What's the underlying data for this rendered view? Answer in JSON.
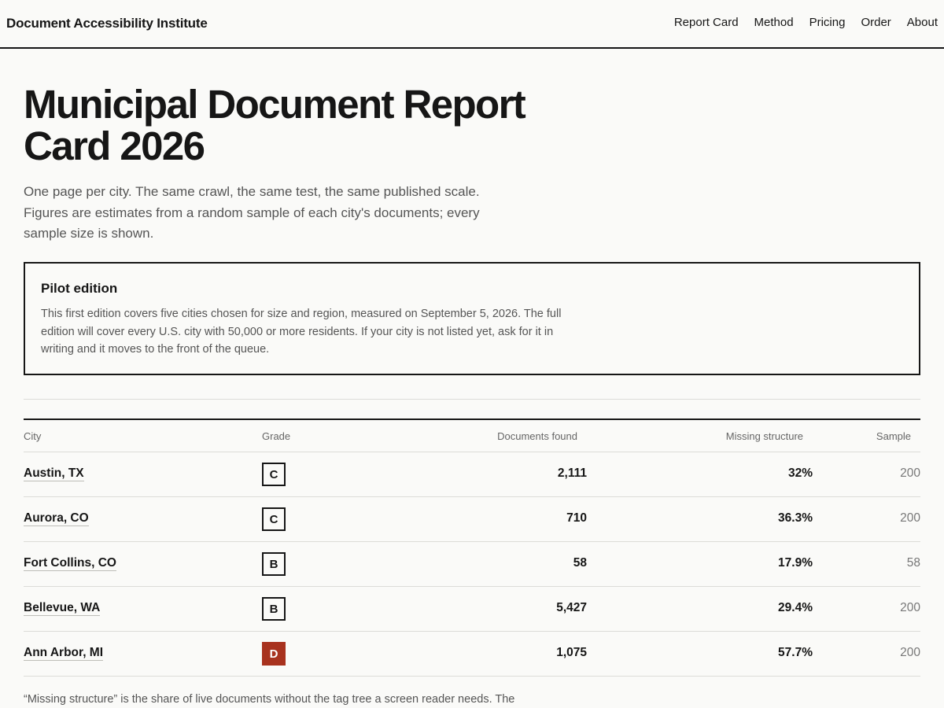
{
  "header": {
    "brand": "Document Accessibility Institute",
    "nav": [
      "Report Card",
      "Method",
      "Pricing",
      "Order",
      "About"
    ]
  },
  "hero": {
    "title": "Municipal Document Report Card 2026",
    "subtitle": "One page per city. The same crawl, the same test, the same published scale. Figures are estimates from a random sample of each city's documents; every sample size is shown."
  },
  "callout": {
    "title": "Pilot edition",
    "body": "This first edition covers five cities chosen for size and region, measured on September 5, 2026. The full edition will cover every U.S. city with 50,000 or more residents. If your city is not listed yet, ask for it in writing and it moves to the front of the queue."
  },
  "table": {
    "headers": {
      "city": "City",
      "grade": "Grade",
      "docs": "Documents found",
      "missing": "Missing structure",
      "sample": "Sample"
    },
    "rows": [
      {
        "city": "Austin, TX",
        "grade": "C",
        "docs": "2,111",
        "missing": "32%",
        "sample": "200"
      },
      {
        "city": "Aurora, CO",
        "grade": "C",
        "docs": "710",
        "missing": "36.3%",
        "sample": "200"
      },
      {
        "city": "Fort Collins, CO",
        "grade": "B",
        "docs": "58",
        "missing": "17.9%",
        "sample": "58"
      },
      {
        "city": "Bellevue, WA",
        "grade": "B",
        "docs": "5,427",
        "missing": "29.4%",
        "sample": "200"
      },
      {
        "city": "Ann Arbor, MI",
        "grade": "D",
        "docs": "1,075",
        "missing": "57.7%",
        "sample": "200"
      }
    ]
  },
  "footnote": "“Missing structure” is the share of live documents without the tag tree a screen reader needs. The",
  "colors": {
    "background": "#fafaf8",
    "text": "#161616",
    "grade_d": "#a8321e"
  }
}
